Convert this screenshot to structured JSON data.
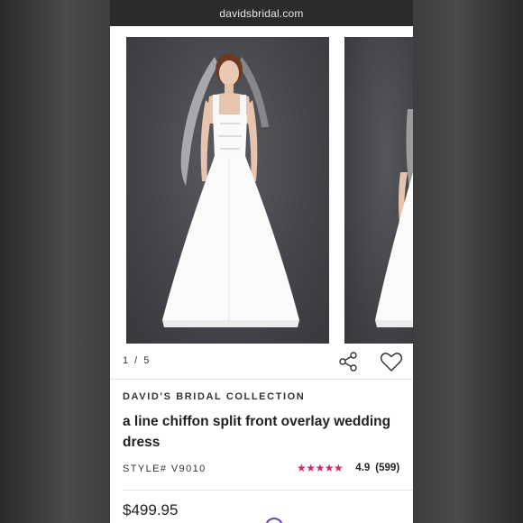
{
  "browser": {
    "url": "davidsbridal.com"
  },
  "gallery": {
    "counter": "1 / 5"
  },
  "product": {
    "brand": "DAVID'S BRIDAL COLLECTION",
    "title": "a line chiffon split front overlay wedding dress",
    "style": "STYLE# V9010",
    "rating_stars": "★★★★★",
    "rating_value": "4.9",
    "review_count": "(599)",
    "price": "$499.95"
  },
  "colors": {
    "star": "#d6246e",
    "url_bar": "#2b2b2b"
  }
}
